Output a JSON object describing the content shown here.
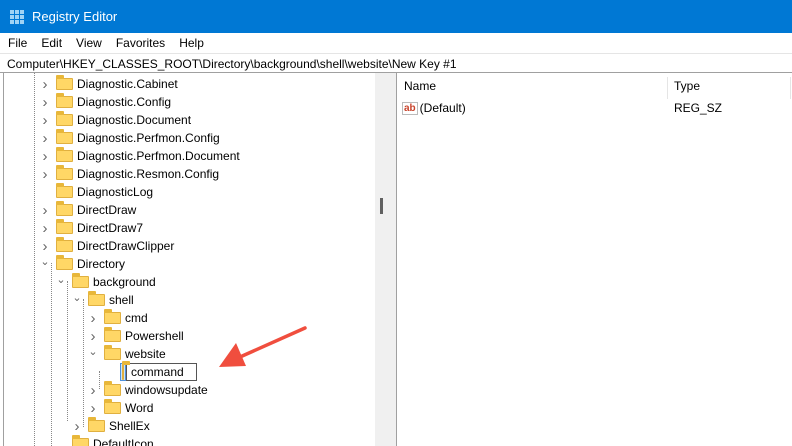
{
  "window": {
    "title": "Registry Editor"
  },
  "menu": [
    "File",
    "Edit",
    "View",
    "Favorites",
    "Help"
  ],
  "address": "Computer\\HKEY_CLASSES_ROOT\\Directory\\background\\shell\\website\\New Key #1",
  "tree": [
    {
      "label": "Diagnostic.Cabinet",
      "level": 0,
      "state": "collapsed"
    },
    {
      "label": "Diagnostic.Config",
      "level": 0,
      "state": "collapsed"
    },
    {
      "label": "Diagnostic.Document",
      "level": 0,
      "state": "collapsed"
    },
    {
      "label": "Diagnostic.Perfmon.Config",
      "level": 0,
      "state": "collapsed"
    },
    {
      "label": "Diagnostic.Perfmon.Document",
      "level": 0,
      "state": "collapsed"
    },
    {
      "label": "Diagnostic.Resmon.Config",
      "level": 0,
      "state": "collapsed"
    },
    {
      "label": "DiagnosticLog",
      "level": 0,
      "state": "leaf"
    },
    {
      "label": "DirectDraw",
      "level": 0,
      "state": "collapsed"
    },
    {
      "label": "DirectDraw7",
      "level": 0,
      "state": "collapsed"
    },
    {
      "label": "DirectDrawClipper",
      "level": 0,
      "state": "collapsed"
    },
    {
      "label": "Directory",
      "level": 0,
      "state": "expanded"
    },
    {
      "label": "background",
      "level": 1,
      "state": "expanded"
    },
    {
      "label": "shell",
      "level": 2,
      "state": "expanded"
    },
    {
      "label": "cmd",
      "level": 3,
      "state": "collapsed"
    },
    {
      "label": "Powershell",
      "level": 3,
      "state": "collapsed"
    },
    {
      "label": "website",
      "level": 3,
      "state": "expanded"
    },
    {
      "label": "command",
      "level": 4,
      "state": "editing"
    },
    {
      "label": "windowsupdate",
      "level": 3,
      "state": "collapsed"
    },
    {
      "label": "Word",
      "level": 3,
      "state": "collapsed"
    },
    {
      "label": "ShellEx",
      "level": 2,
      "state": "collapsed"
    },
    {
      "label": "DefaultIcon",
      "level": 1,
      "state": "leaf"
    }
  ],
  "list": {
    "columns": {
      "name": "Name",
      "type": "Type"
    },
    "rows": [
      {
        "icon": "ab",
        "name": "(Default)",
        "type": "REG_SZ"
      }
    ]
  },
  "colors": {
    "titlebar": "#0078d4",
    "arrow": "#f04e3e"
  }
}
